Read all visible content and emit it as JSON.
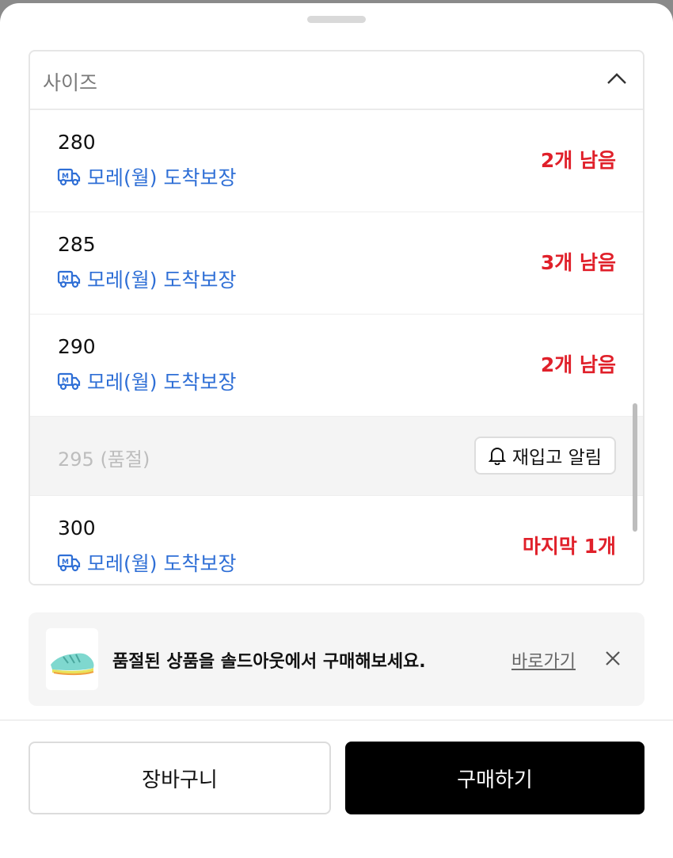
{
  "backdrop_text": "",
  "dropdown": {
    "label": "사이즈",
    "chevron_icon": "chevron-up-icon"
  },
  "options": [
    {
      "size": "280",
      "delivery": "모레(월) 도착보장",
      "stock": "2개 남음",
      "sold_out": false
    },
    {
      "size": "285",
      "delivery": "모레(월) 도착보장",
      "stock": "3개 남음",
      "sold_out": false
    },
    {
      "size": "290",
      "delivery": "모레(월) 도착보장",
      "stock": "2개 남음",
      "sold_out": false
    },
    {
      "size": "295 (품절)",
      "restock_label": "재입고 알림",
      "sold_out": true
    },
    {
      "size": "300",
      "delivery": "모레(월) 도착보장",
      "stock": "마지막 1개",
      "sold_out": false
    }
  ],
  "banner": {
    "text": "품절된 상품을 솔드아웃에서 구매해보세요.",
    "link": "바로가기",
    "close_icon": "close-icon"
  },
  "buttons": {
    "cart": "장바구니",
    "buy": "구매하기"
  },
  "colors": {
    "accent_blue": "#2f6fd6",
    "stock_red": "#e0202a",
    "buy_button": "#000000"
  }
}
